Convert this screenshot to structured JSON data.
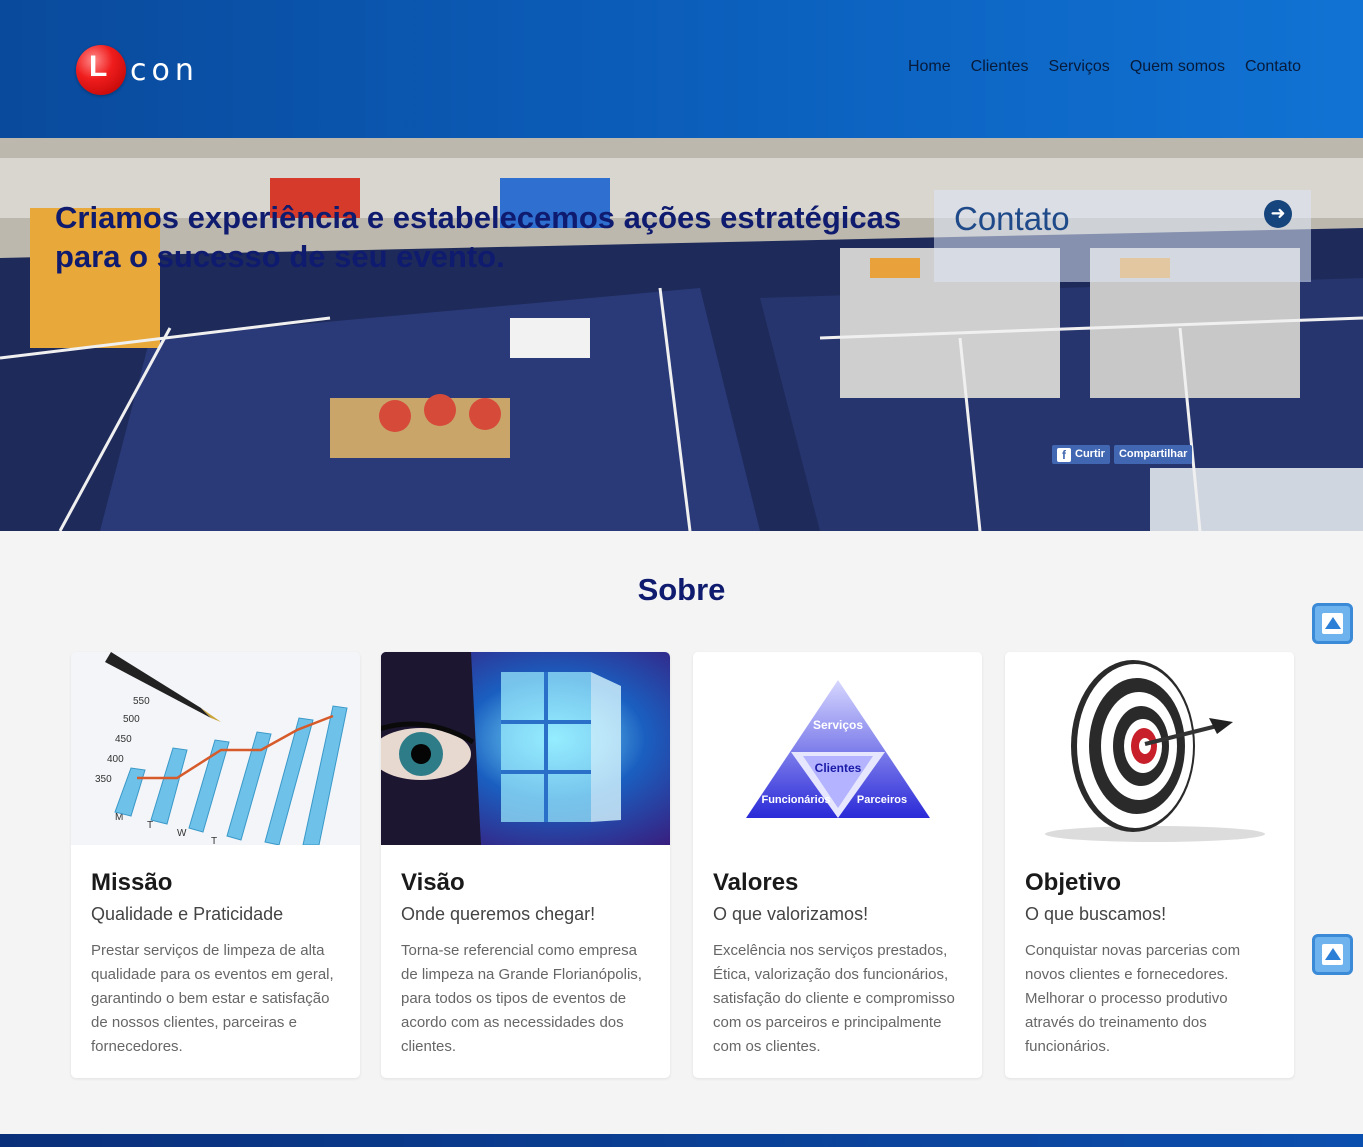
{
  "header": {
    "logo_letter": "L",
    "logo_text": "con",
    "nav": [
      "Home",
      "Clientes",
      "Serviços",
      "Quem somos",
      "Contato"
    ]
  },
  "hero": {
    "headline": "Criamos experiência e estabelecemos ações estratégicas para o sucesso de seu evento.",
    "contact_label": "Contato",
    "fb_like": "Curtir",
    "fb_share": "Compartilhar"
  },
  "section": {
    "title": "Sobre",
    "cards": [
      {
        "title": "Missão",
        "subtitle": "Qualidade e Praticidade",
        "body": "Prestar serviços de limpeza de alta qualidade para os eventos em geral, garantindo o bem estar e satisfação de nossos clientes, parceiras e fornecedores."
      },
      {
        "title": "Visão",
        "subtitle": "Onde queremos chegar!",
        "body": "Torna-se referencial como empresa de limpeza na Grande Florianópolis, para todos os tipos de eventos de acordo com as necessidades dos clientes."
      },
      {
        "title": "Valores",
        "subtitle": "O que valorizamos!",
        "body": "Excelência nos serviços prestados, Ética, valorização dos funcionários, satisfação do cliente e compromisso com os parceiros e principalmente com os clientes."
      },
      {
        "title": "Objetivo",
        "subtitle": "O que buscamos!",
        "body": "Conquistar novas parcerias com novos clientes e fornecedores. Melhorar o processo produtivo através do treinamento dos funcionários."
      }
    ],
    "pyramid": {
      "top": "Serviços",
      "middle": "Clientes",
      "left": "Funcionários",
      "right": "Parceiros"
    },
    "chart_ticks": [
      "550",
      "500",
      "450",
      "400",
      "350"
    ],
    "chart_days": [
      "M",
      "T",
      "W",
      "T"
    ]
  },
  "colors": {
    "header_start": "#0a4a9c",
    "header_end": "#1173d4",
    "accent_navy": "#0f1b6e",
    "scroll_button": "#6fb3ee"
  },
  "icons": [
    "arrow-right-circle-icon",
    "facebook-icon",
    "scroll-up-icon"
  ]
}
